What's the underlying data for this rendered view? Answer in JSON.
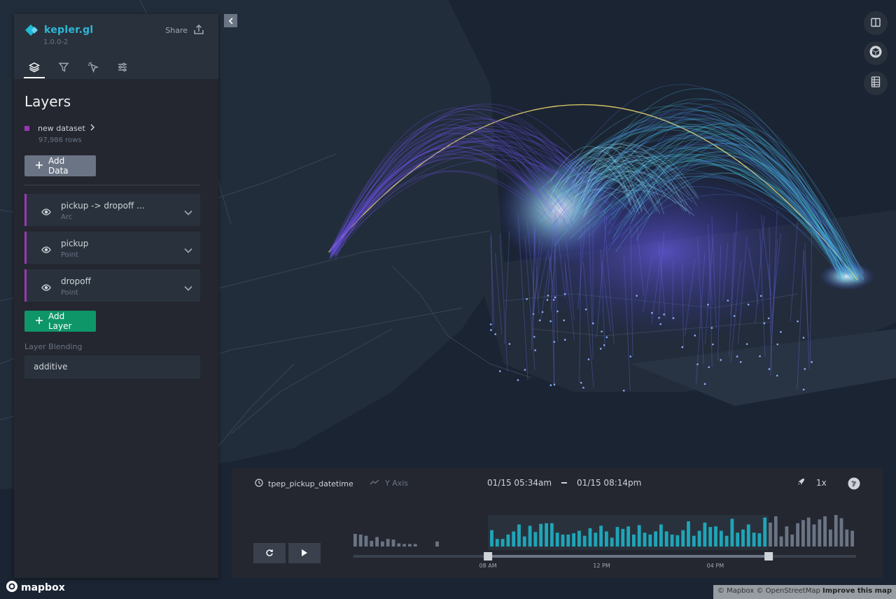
{
  "app": {
    "name": "kepler.gl",
    "version": "1.0.0-2",
    "share_label": "Share"
  },
  "tabs": [
    {
      "id": "layers",
      "icon": "layers-icon",
      "active": true
    },
    {
      "id": "filters",
      "icon": "filter-icon",
      "active": false
    },
    {
      "id": "interactions",
      "icon": "cursor-click-icon",
      "active": false
    },
    {
      "id": "map-style",
      "icon": "sliders-icon",
      "active": false
    }
  ],
  "panel": {
    "title": "Layers",
    "dataset": {
      "name": "new dataset",
      "rows": "97,986 rows",
      "color": "#9b36b7"
    },
    "add_data_label": "Add Data",
    "layers": [
      {
        "name": "pickup -> dropoff ...",
        "type": "Arc",
        "color": "#9b36b7"
      },
      {
        "name": "pickup",
        "type": "Point",
        "color": "#9b36b7"
      },
      {
        "name": "dropoff",
        "type": "Point",
        "color": "#9b36b7"
      }
    ],
    "add_layer_label": "Add Layer",
    "blending_label": "Layer Blending",
    "blending_value": "additive"
  },
  "map_controls": [
    {
      "icon": "split-map-icon"
    },
    {
      "icon": "3d-cube-icon"
    },
    {
      "icon": "legend-table-icon"
    }
  ],
  "timeline": {
    "field": "tpep_pickup_datetime",
    "y_axis_label": "Y Axis",
    "range_start": "01/15 05:34am",
    "range_end": "01/15 08:14pm",
    "speed": "1x",
    "ticks": [
      "08 AM",
      "12 PM",
      "04 PM"
    ],
    "histogram": {
      "values": [
        20,
        19,
        17,
        9,
        15,
        8,
        12,
        11,
        5,
        4,
        4,
        4,
        0,
        0,
        0,
        8,
        0,
        0,
        0,
        0,
        0,
        0,
        0,
        0,
        0,
        26,
        12,
        12,
        19,
        24,
        35,
        16,
        33,
        23,
        36,
        37,
        37,
        22,
        19,
        19,
        21,
        25,
        17,
        29,
        22,
        33,
        24,
        14,
        31,
        28,
        32,
        19,
        34,
        22,
        19,
        24,
        35,
        24,
        19,
        18,
        26,
        40,
        17,
        25,
        38,
        31,
        32,
        25,
        17,
        44,
        22,
        27,
        35,
        22,
        21,
        46,
        38,
        48,
        16,
        32,
        19,
        37,
        42,
        46,
        35,
        43,
        48,
        27,
        50,
        45,
        27,
        25
      ],
      "selected_range": [
        25,
        75
      ],
      "highlight_color": "#1fa5b8",
      "muted_color": "#6a7485"
    }
  },
  "attribution": {
    "mapbox": "© Mapbox",
    "osm": "© OpenStreetMap",
    "improve": "Improve this map",
    "logo": "mapbox"
  },
  "colors": {
    "panel_bg": "#242730",
    "accent_teal": "#1fbad6",
    "add_layer_green": "#0f9668",
    "arc_start": "#5a3cd6",
    "arc_end": "#4bd6f0"
  }
}
